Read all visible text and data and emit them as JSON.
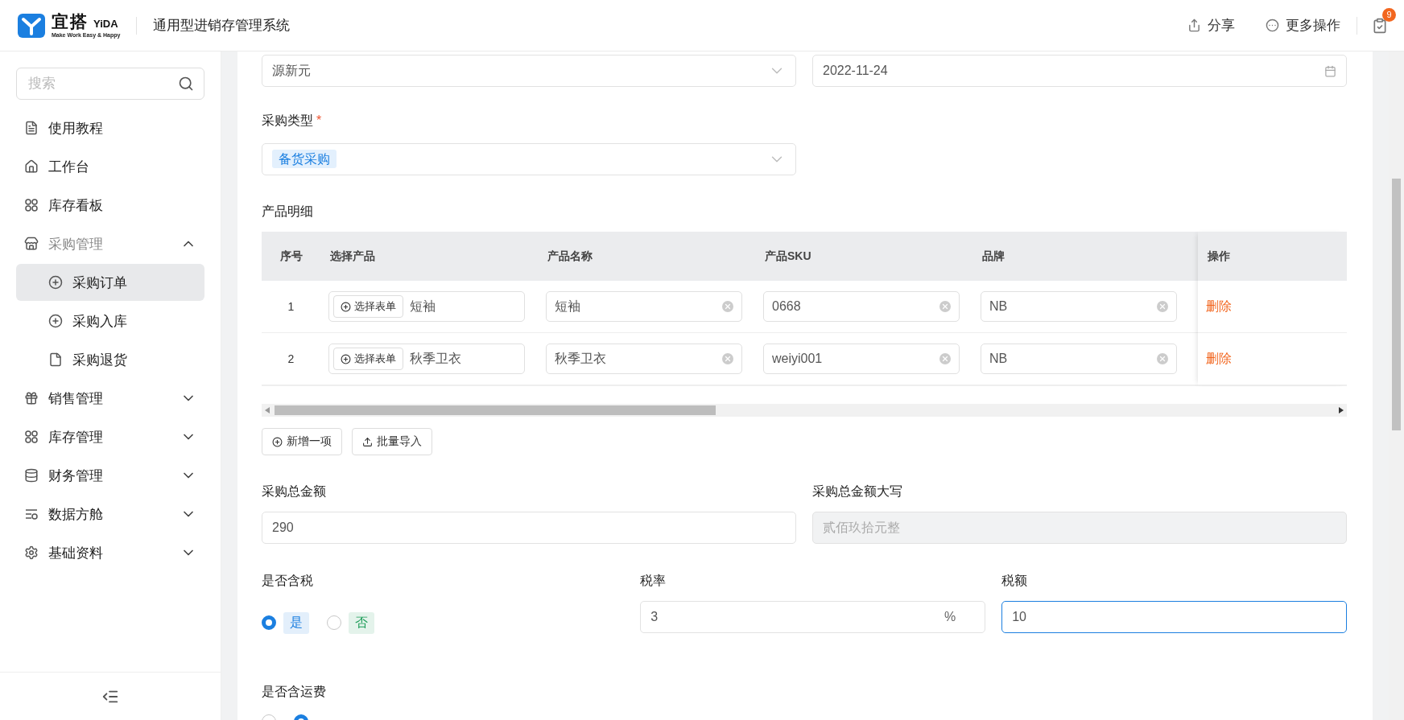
{
  "header": {
    "logo": {
      "name": "宜搭",
      "latin": "YiDA",
      "slogan": "Make Work Easy & Happy"
    },
    "app_title": "通用型进销存管理系统",
    "actions": [
      {
        "kind": "share",
        "label": "分享"
      },
      {
        "kind": "more",
        "label": "更多操作"
      }
    ],
    "todo_badge": "9"
  },
  "sidebar": {
    "search": {
      "placeholder": "搜索"
    },
    "items": [
      {
        "kind": "link",
        "label": "使用教程",
        "selected": false
      },
      {
        "kind": "link",
        "label": "工作台",
        "selected": false
      },
      {
        "kind": "link",
        "label": "库存看板",
        "selected": false
      },
      {
        "kind": "group",
        "label": "采购管理",
        "expanded": true,
        "children": [
          {
            "label": "采购订单",
            "selected": true
          },
          {
            "label": "采购入库",
            "selected": false
          },
          {
            "label": "采购退货",
            "selected": false
          }
        ]
      },
      {
        "kind": "group",
        "label": "销售管理",
        "expanded": false
      },
      {
        "kind": "group",
        "label": "库存管理",
        "expanded": false
      },
      {
        "kind": "group",
        "label": "财务管理",
        "expanded": false
      },
      {
        "kind": "group",
        "label": "数据方舱",
        "expanded": false
      },
      {
        "kind": "group",
        "label": "基础资料",
        "expanded": false
      }
    ]
  },
  "form": {
    "top_fields": [
      {
        "kind": "select",
        "value": "源新元"
      },
      {
        "kind": "date",
        "value": "2022-11-24"
      }
    ],
    "purchase_type": {
      "label": "采购类型",
      "required_mark": "*",
      "tag": "备货采购"
    },
    "product_details": {
      "label": "产品明细",
      "columns": [
        "序号",
        "选择产品",
        "产品名称",
        "产品SKU",
        "品牌"
      ],
      "action_column": "操作",
      "rows": [
        {
          "index": "1",
          "pick_button": "选择表单",
          "product": "短袖",
          "name": "短袖",
          "sku": "0668",
          "brand": "NB",
          "action": "删除"
        },
        {
          "index": "2",
          "pick_button": "选择表单",
          "product": "秋季卫衣",
          "name": "秋季卫衣",
          "sku": "weiyi001",
          "brand": "NB",
          "action": "删除"
        }
      ],
      "buttons": [
        {
          "kind": "add",
          "label": "新增一项"
        },
        {
          "kind": "import",
          "label": "批量导入"
        }
      ]
    },
    "total": {
      "label": "采购总金额",
      "value": "290",
      "disabled": false
    },
    "total_upper": {
      "label": "采购总金额大写",
      "value": "贰佰玖拾元整",
      "disabled": true
    },
    "tax_included": {
      "label": "是否含税",
      "options": [
        {
          "label": "是",
          "selected": true,
          "color": "#1b7fe0"
        },
        {
          "label": "否",
          "selected": false,
          "color": "#1f9e5a"
        }
      ]
    },
    "tax_rate": {
      "label": "税率",
      "value": "3",
      "unit": "%",
      "focused": false
    },
    "tax_amount": {
      "label": "税额",
      "value": "10",
      "focused": true
    },
    "freight_included": {
      "label": "是否含运费",
      "options": [
        {
          "selected": false
        },
        {
          "selected": true
        }
      ]
    }
  }
}
